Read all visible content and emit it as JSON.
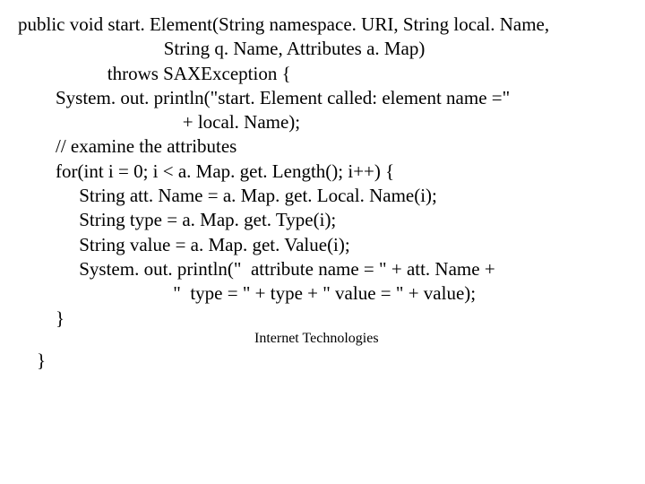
{
  "code": {
    "l1": "public void start. Element(String namespace. URI, String local. Name,",
    "l2": "                               String q. Name, Attributes a. Map)",
    "l3": "                   throws SAXException {",
    "l4": "",
    "l5": "        System. out. println(\"start. Element called: element name =\"",
    "l6": "                                   + local. Name);",
    "l7": "",
    "l8": "        // examine the attributes",
    "l9": "",
    "l10": "        for(int i = 0; i < a. Map. get. Length(); i++) {",
    "l11": "",
    "l12": "             String att. Name = a. Map. get. Local. Name(i);",
    "l13": "             String type = a. Map. get. Type(i);",
    "l14": "             String value = a. Map. get. Value(i);",
    "l15": "             System. out. println(\"  attribute name = \" + att. Name +",
    "l16": "                                 \"  type = \" + type + \" value = \" + value);",
    "l17": "        }",
    "l18": "    }"
  },
  "footer": "Internet Technologies"
}
